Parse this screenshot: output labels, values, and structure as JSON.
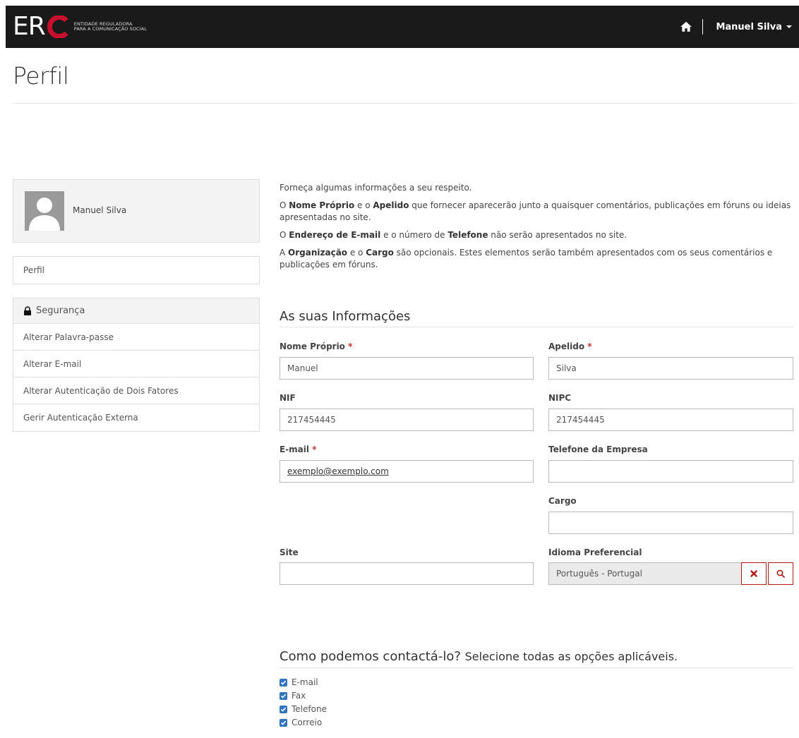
{
  "header": {
    "logo_letters": "ER",
    "logo_sub_line1": "ENTIDADE REGULADORA",
    "logo_sub_line2": "PARA A COMUNICAÇÃO SOCIAL",
    "user_name": "Manuel Silva",
    "icons": {
      "home": "home-icon",
      "caret": "caret-down-icon"
    }
  },
  "page": {
    "title": "Perfil"
  },
  "sidebar": {
    "profile_name": "Manuel Silva",
    "profile_link": "Perfil",
    "security_title": "Segurança",
    "security_items": [
      "Alterar Palavra-passe",
      "Alterar E-mail",
      "Alterar Autenticação de Dois Fatores",
      "Gerir Autenticação Externa"
    ]
  },
  "intro": {
    "p1": "Forneça algumas informações a seu respeito.",
    "p2_pre": "O ",
    "p2_b1": "Nome Próprio",
    "p2_mid": " e o ",
    "p2_b2": "Apelido",
    "p2_post": " que fornecer aparecerão junto a quaisquer comentários, publicações em fóruns ou ideias apresentadas no site.",
    "p3_pre": "O ",
    "p3_b1": "Endereço de E-mail",
    "p3_mid": " e o número de ",
    "p3_b2": "Telefone",
    "p3_post": " não serão apresentados no site.",
    "p4_pre": "A ",
    "p4_b1": "Organização",
    "p4_mid": " e o ",
    "p4_b2": "Cargo",
    "p4_post": " são opcionais. Estes elementos serão também apresentados com os seus comentários e publicações em fóruns."
  },
  "form": {
    "section_title": "As suas Informações",
    "required_mark": "*",
    "first_name": {
      "label": "Nome Próprio",
      "value": "Manuel"
    },
    "last_name": {
      "label": "Apelido",
      "value": "Silva"
    },
    "nif": {
      "label": "NIF",
      "value": "217454445"
    },
    "nipc": {
      "label": "NIPC",
      "value": "217454445"
    },
    "email": {
      "label": "E-mail",
      "value": "exemplo@exemplo.com"
    },
    "company_phone": {
      "label": "Telefone da Empresa",
      "value": ""
    },
    "job_title": {
      "label": "Cargo",
      "value": ""
    },
    "website": {
      "label": "Site",
      "value": ""
    },
    "language": {
      "label": "Idioma Preferencial",
      "value": "Português - Portugal"
    }
  },
  "contact": {
    "title": "Como podemos contactá-lo?",
    "subtitle": "Selecione todas as opções aplicáveis.",
    "options": [
      {
        "label": "E-mail",
        "checked": true
      },
      {
        "label": "Fax",
        "checked": true
      },
      {
        "label": "Telefone",
        "checked": true
      },
      {
        "label": "Correio",
        "checked": true
      }
    ]
  },
  "colors": {
    "navbar": "#1a1a1a",
    "brand_red": "#c8102e",
    "check_blue": "#2f74c0",
    "danger_border": "#b51a1a"
  }
}
